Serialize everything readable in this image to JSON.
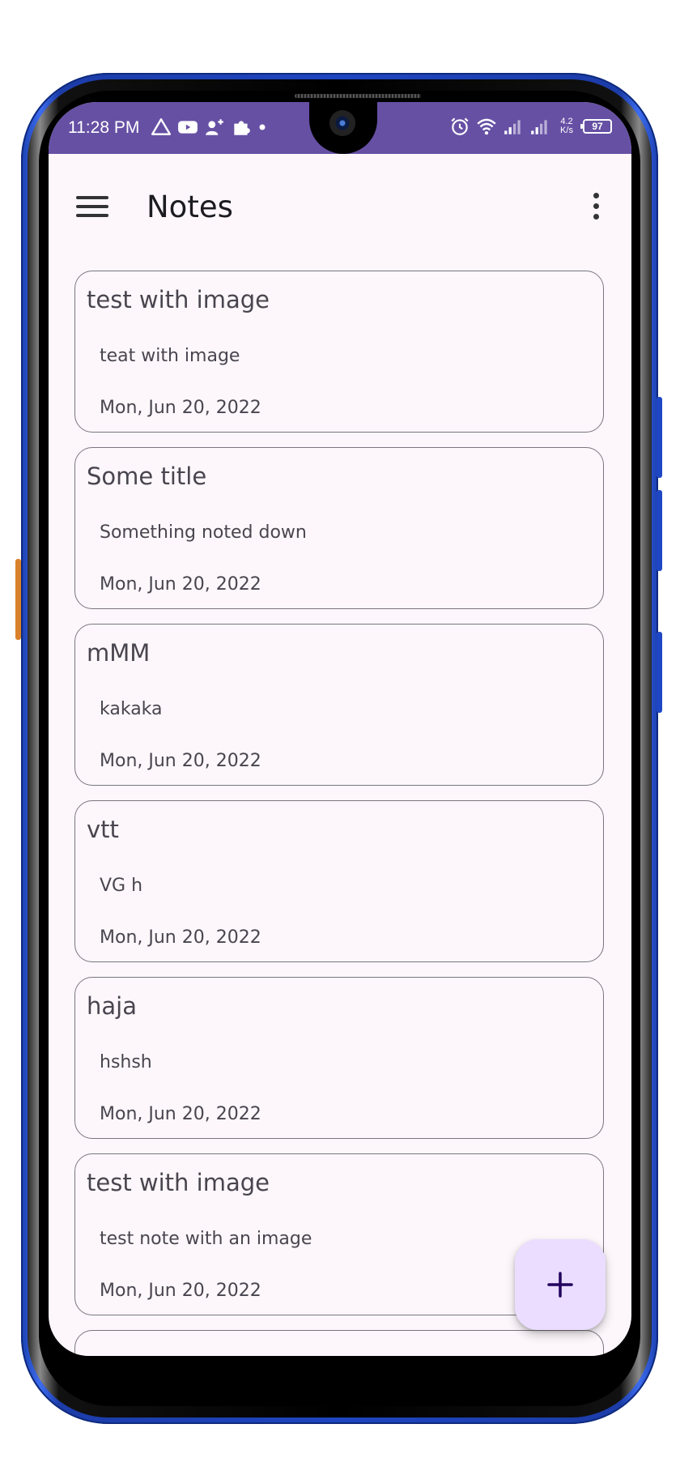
{
  "status_bar": {
    "time": "11:28 PM",
    "network_speed_value": "4.2",
    "network_speed_unit": "K/s",
    "battery_level": "97",
    "left_icons": [
      "warning-triangle-icon",
      "youtube-icon",
      "person-add-icon",
      "extension-icon",
      "dot-icon"
    ],
    "right_icons": [
      "alarm-icon",
      "wifi-icon",
      "signal-icon",
      "signal-icon"
    ],
    "background_color": "#6650a4"
  },
  "app_bar": {
    "title": "Notes",
    "menu_icon": "menu-icon",
    "overflow_icon": "more-vert-icon"
  },
  "notes": [
    {
      "title": "test with image",
      "body": "teat with image",
      "date": "Mon,  Jun 20, 2022"
    },
    {
      "title": "Some title",
      "body": "Something noted down",
      "date": "Mon,  Jun 20, 2022"
    },
    {
      "title": "mMM",
      "body": "kakaka",
      "date": "Mon,  Jun 20, 2022"
    },
    {
      "title": "vtt",
      "body": "VG h",
      "date": "Mon,  Jun 20, 2022"
    },
    {
      "title": "haja",
      "body": "hshsh",
      "date": "Mon,  Jun 20, 2022"
    },
    {
      "title": "test with image",
      "body": "test note with an image",
      "date": "Mon,  Jun 20, 2022"
    }
  ],
  "fab": {
    "icon": "plus-icon",
    "color": "#eaddff"
  },
  "colors": {
    "screen_background": "#fdf7fb",
    "card_border": "#7a757f",
    "text": "#49454f",
    "device_frame": "#1e45c0"
  }
}
